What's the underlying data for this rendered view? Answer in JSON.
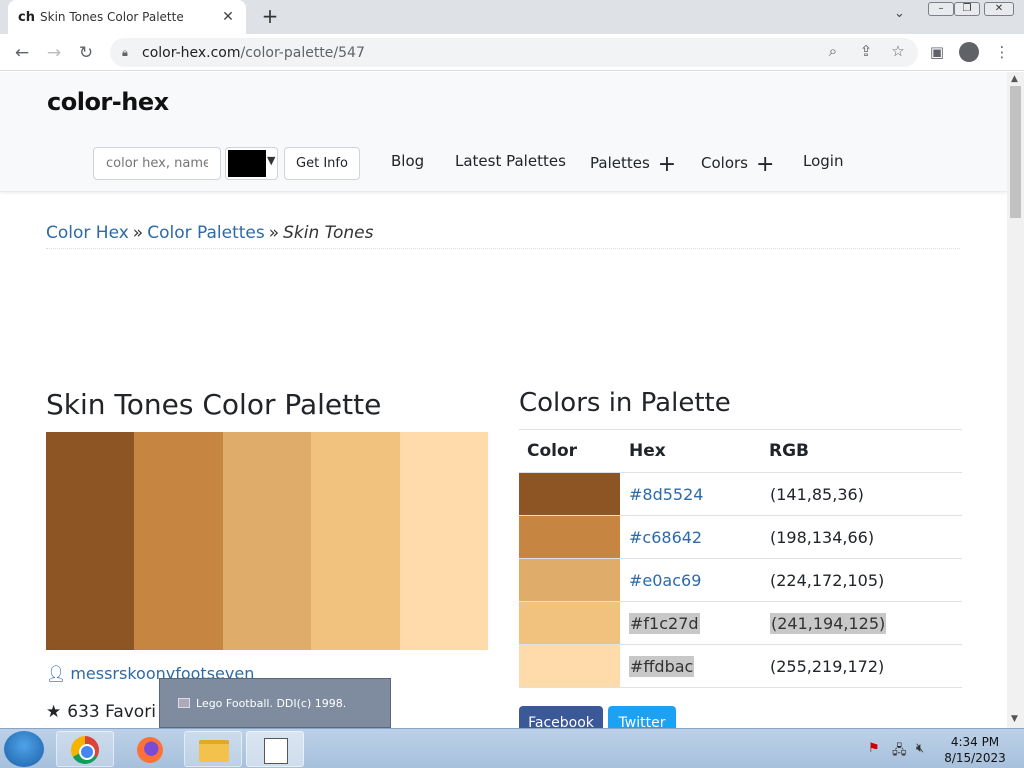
{
  "browser": {
    "tab_favicon": "ch",
    "tab_title": "Skin Tones Color Palette",
    "tab_close": "✕",
    "new_tab": "+",
    "url_host": "color-hex.com",
    "url_path": "/color-palette/547"
  },
  "site": {
    "logo": "color-hex",
    "search_placeholder": "color hex, name, rgb",
    "picker_color": "#000000",
    "get_info_label": "Get Info",
    "nav": [
      {
        "label": "Blog"
      },
      {
        "label": "Latest Palettes"
      },
      {
        "label": "Palettes",
        "plus": "+"
      },
      {
        "label": "Colors",
        "plus": "+"
      },
      {
        "label": "Login"
      }
    ]
  },
  "breadcrumb": {
    "items": [
      "Color Hex",
      "Color Palettes"
    ],
    "separator": "»",
    "current": "Skin Tones"
  },
  "palette": {
    "title": "Skin Tones Color Palette",
    "author": "messrskoonyfootseven",
    "favorites_count": "633",
    "favorites_label": "Favori",
    "colors": [
      "#8d5524",
      "#c68642",
      "#e0ac69",
      "#f1c27d",
      "#ffdbac"
    ]
  },
  "colors_table": {
    "title": "Colors in Palette",
    "headers": [
      "Color",
      "Hex",
      "RGB"
    ],
    "rows": [
      {
        "hex": "#8d5524",
        "rgb": "(141,85,36)"
      },
      {
        "hex": "#c68642",
        "rgb": "(198,134,66)"
      },
      {
        "hex": "#e0ac69",
        "rgb": "(224,172,105)"
      },
      {
        "hex": "#f1c27d",
        "rgb": "(241,194,125)"
      },
      {
        "hex": "#ffdbac",
        "rgb": "(255,219,172)"
      }
    ]
  },
  "share": {
    "facebook": "Facebook",
    "twitter": "Twitter",
    "facebook_color": "#3b5998",
    "twitter_color": "#1da1f2"
  },
  "tooltip": {
    "text": "Lego Football.  DDI(c) 1998."
  },
  "taskbar": {
    "time": "4:34 PM",
    "date": "8/15/2023"
  }
}
